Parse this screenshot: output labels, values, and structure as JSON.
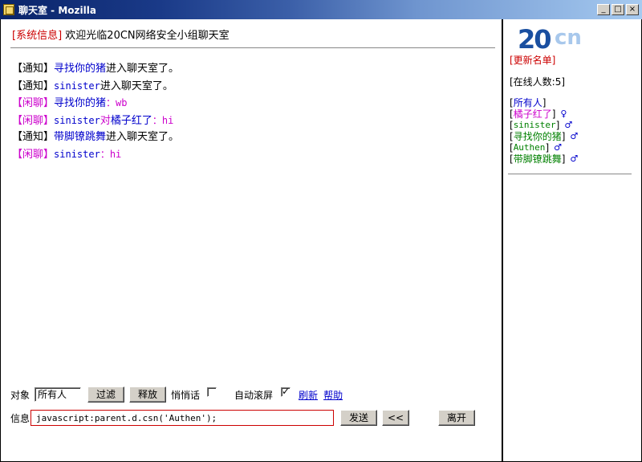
{
  "window": {
    "title": "聊天室 - Mozilla"
  },
  "system": {
    "tag": "[系统信息]",
    "text": "欢迎光临20CN网络安全小组聊天室"
  },
  "messages": [
    {
      "tag": "【通知】",
      "name": "寻找你的猪",
      "text": "进入聊天室了。"
    },
    {
      "tag": "【通知】",
      "name": "sinister",
      "text": "进入聊天室了。"
    },
    {
      "tag": "【闲聊】",
      "name": "寻找你的猪",
      "text": "：wb"
    },
    {
      "tag": "【闲聊】",
      "name": "sinister",
      "mid": "对",
      "to": "橘子红了",
      "text": "：hi"
    },
    {
      "tag": "【通知】",
      "name": "带脚镣跳舞",
      "text": "进入聊天室了。"
    },
    {
      "tag": "【闲聊】",
      "name": "sinister",
      "text": "：hi"
    }
  ],
  "controls": {
    "target_label": "对象",
    "target_value": "所有人",
    "filter_label": "过滤",
    "release_label": "释放",
    "whisper_label": "悄悄话",
    "autoscroll_label": "自动滚屏",
    "refresh_label": "刷新",
    "help_label": "帮助",
    "message_label": "信息",
    "message_value": "javascript:parent.d.csn('Authen');",
    "send_label": "发送",
    "back_label": "<<",
    "leave_label": "离开"
  },
  "sidebar": {
    "logo_main": "20",
    "logo_sub": "cn",
    "update_label": "[更新名单]",
    "online_label": "[在线人数:5]",
    "users": [
      {
        "name": "所有人",
        "color": "#0000cc",
        "gender": ""
      },
      {
        "name": "橘子红了",
        "color": "#cc00cc",
        "gender": "♀"
      },
      {
        "name": "sinister",
        "color": "#008000",
        "gender": "♂"
      },
      {
        "name": "寻找你的猪",
        "color": "#008000",
        "gender": "♂"
      },
      {
        "name": "Authen",
        "color": "#008000",
        "gender": "♂"
      },
      {
        "name": "带脚镣跳舞",
        "color": "#008000",
        "gender": "♂"
      }
    ]
  },
  "colors": {
    "system_tag": "#cc0000",
    "notice_name": "#0000cc",
    "chat": "#cc00cc",
    "user_green": "#008000"
  }
}
